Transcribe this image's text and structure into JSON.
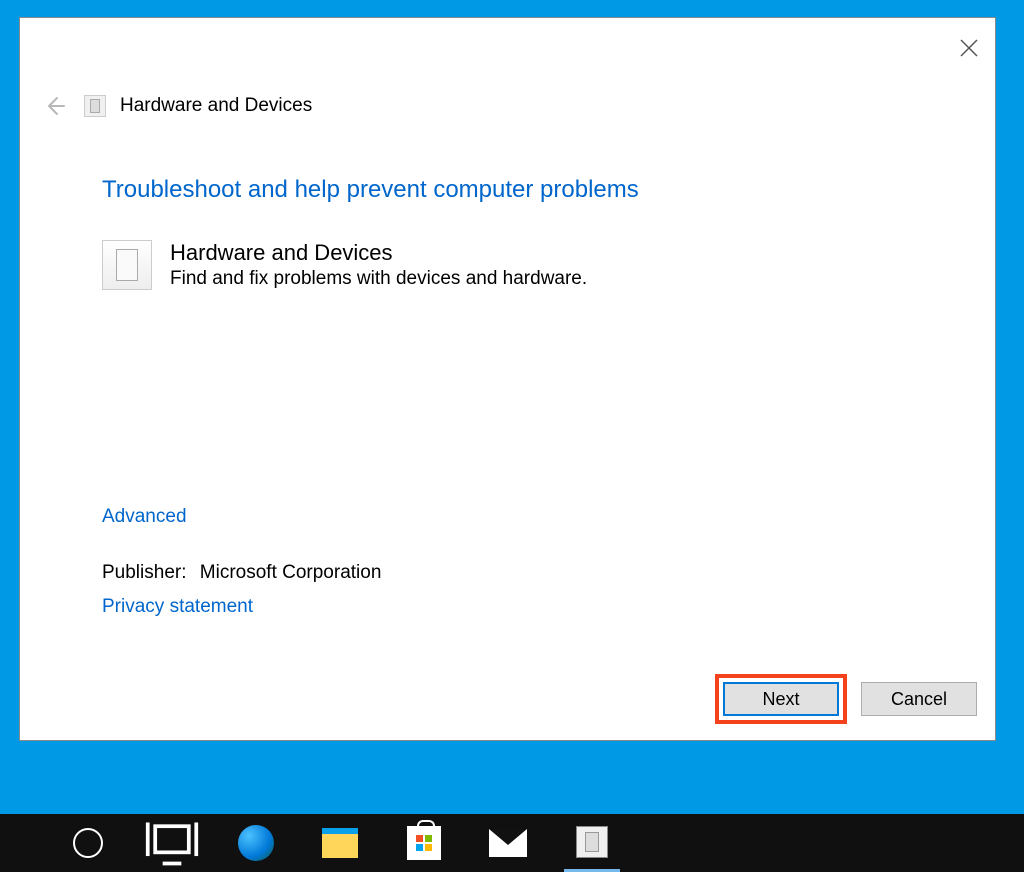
{
  "dialog": {
    "title": "Hardware and Devices",
    "heading": "Troubleshoot and help prevent computer problems",
    "item": {
      "name": "Hardware and Devices",
      "desc": "Find and fix problems with devices and hardware."
    },
    "advanced": "Advanced",
    "publisher_label": "Publisher:",
    "publisher_value": "Microsoft Corporation",
    "privacy": "Privacy statement",
    "buttons": {
      "next": "Next",
      "cancel": "Cancel"
    }
  }
}
